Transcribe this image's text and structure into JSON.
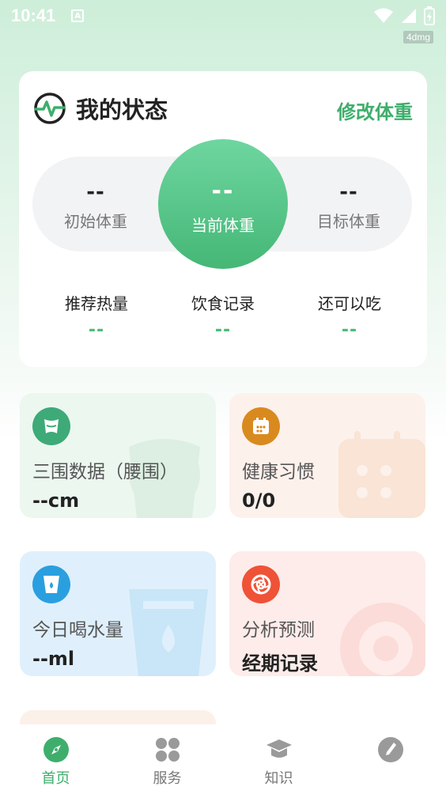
{
  "status_bar": {
    "time": "10:41",
    "badge": "A"
  },
  "watermark": "4dmg",
  "status_card": {
    "title": "我的状态",
    "edit_weight": "修改体重",
    "initial_weight": {
      "value": "--",
      "label": "初始体重"
    },
    "current_weight": {
      "value": "--",
      "label": "当前体重"
    },
    "target_weight": {
      "value": "--",
      "label": "目标体重"
    },
    "stats": [
      {
        "label": "推荐热量",
        "value": "--"
      },
      {
        "label": "饮食记录",
        "value": "--"
      },
      {
        "label": "还可以吃",
        "value": "--"
      }
    ]
  },
  "tiles": {
    "waist": {
      "label": "三围数据（腰围）",
      "value": "--cm",
      "icon": "waist-icon"
    },
    "habit": {
      "label": "健康习惯",
      "value": "0/0",
      "icon": "calendar-icon"
    },
    "water": {
      "label": "今日喝水量",
      "value": "--ml",
      "icon": "water-cup-icon"
    },
    "period": {
      "label": "分析预测",
      "value": "经期记录",
      "icon": "flower-icon"
    }
  },
  "tabbar": {
    "tabs": [
      {
        "label": "首页",
        "icon": "compass-icon",
        "active": true
      },
      {
        "label": "服务",
        "icon": "grid-icon",
        "active": false
      },
      {
        "label": "知识",
        "icon": "graduation-cap-icon",
        "active": false
      },
      {
        "label": "",
        "icon": "pen-icon",
        "active": false
      }
    ]
  },
  "colors": {
    "accent": "#3fae6c",
    "stat_value": "#4cbb7a",
    "waist_icon_bg": "#3daa78",
    "habit_icon_bg": "#d98a1f",
    "water_icon_bg": "#2a9fe0",
    "period_icon_bg": "#ef5237"
  }
}
